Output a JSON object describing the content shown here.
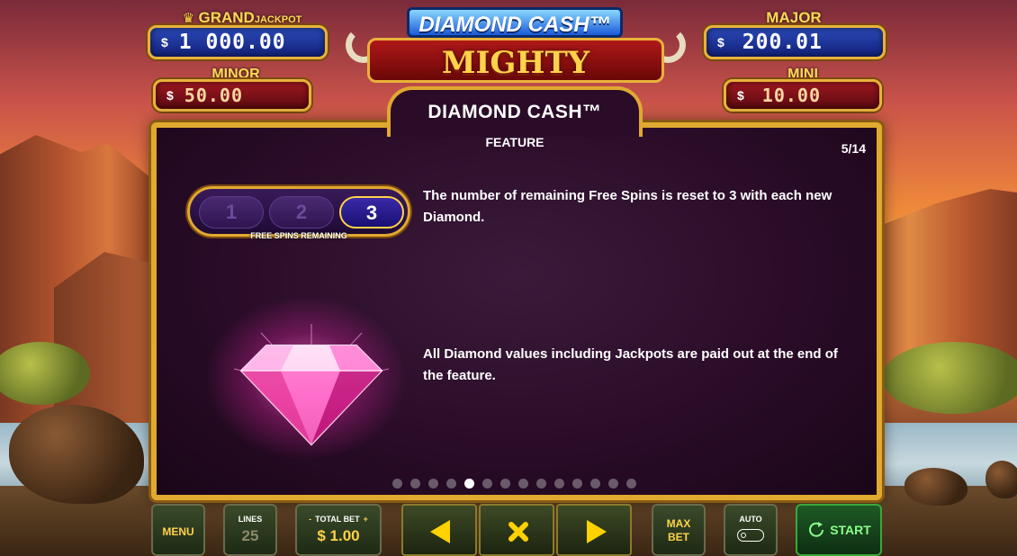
{
  "game": {
    "logo_top": "DIAMOND CASH™",
    "logo_main": "MIGHTY BUFFALO"
  },
  "jackpots": {
    "grand": {
      "label": "GRAND",
      "label_suffix": "JACKPOT",
      "currency": "$",
      "amount": "1 000.00"
    },
    "major": {
      "label": "MAJOR",
      "currency": "$",
      "amount": "200.01"
    },
    "minor": {
      "label": "MINOR",
      "currency": "$",
      "amount": "50.00"
    },
    "mini": {
      "label": "MINI",
      "currency": "$",
      "amount": "10.00"
    }
  },
  "dialog": {
    "title": "DIAMOND CASH™",
    "subtitle": "FEATURE",
    "page_counter": "5/14",
    "current_page": 5,
    "total_pages": 14,
    "free_spins": {
      "pills": [
        "1",
        "2",
        "3"
      ],
      "active_index": 2,
      "label": "FREE SPINS REMAINING"
    },
    "paragraph_1": "The number of remaining Free Spins is reset to 3 with each new Diamond.",
    "paragraph_2": "All Diamond values including Jackpots are paid out at the end of the feature."
  },
  "bottom_bar": {
    "menu": "MENU",
    "lines_label": "LINES",
    "lines_value": "25",
    "total_bet_label": "TOTAL BET",
    "total_bet_minus": "-",
    "total_bet_plus": "+",
    "total_bet_value": "$ 1.00",
    "max_bet_line1": "MAX",
    "max_bet_line2": "BET",
    "auto": "AUTO",
    "start": "START"
  },
  "colors": {
    "gold": "#e0a930",
    "panel": "#2a0c28",
    "jackpot_blue": "#1a2a9a",
    "jackpot_red": "#8a0e16",
    "nav_arrow": "#ffd200",
    "start_green": "#8aff8a"
  },
  "icons": {
    "crown": "crown-icon",
    "prev": "arrow-left-icon",
    "close": "close-icon",
    "next": "arrow-right-icon",
    "refresh": "refresh-icon",
    "diamond": "diamond-icon"
  }
}
